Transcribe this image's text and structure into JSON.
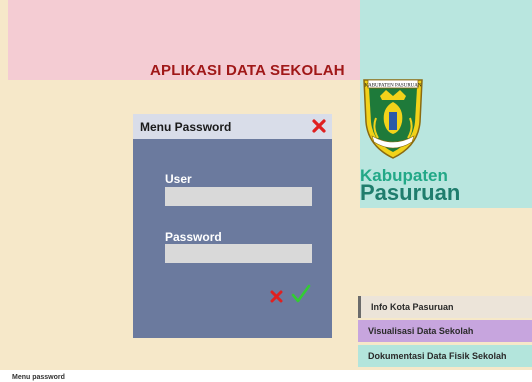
{
  "app": {
    "title": "APLIKASI DATA SEKOLAH"
  },
  "region": {
    "line1": "Kabupaten",
    "line2": "Pasuruan",
    "emblem_icon": "kabupaten-pasuruan-emblem",
    "emblem_banner": "KABUPATEN PASURUAN"
  },
  "dialog": {
    "title": "Menu Password",
    "close_icon": "close-x-icon",
    "user_label": "User",
    "user_value": "",
    "password_label": "Password",
    "password_value": "",
    "cancel_icon": "cancel-x-icon",
    "ok_icon": "checkmark-icon"
  },
  "sidebar": {
    "items": [
      {
        "label": "Info Kota Pasuruan"
      },
      {
        "label": "Visualisasi Data Sekolah"
      },
      {
        "label": "Dokumentasi Data Fisik Sekolah"
      }
    ]
  },
  "status": {
    "text": "Menu password"
  },
  "colors": {
    "beige_bg": "#f6e8c9",
    "pink_header": "#f4ccd3",
    "teal_header": "#b9e6df",
    "dialog_bg": "#6b7a9e",
    "title_red": "#a01818",
    "brand_green": "#1f7d6d",
    "close_red": "#e02020",
    "ok_green": "#33cc33"
  }
}
